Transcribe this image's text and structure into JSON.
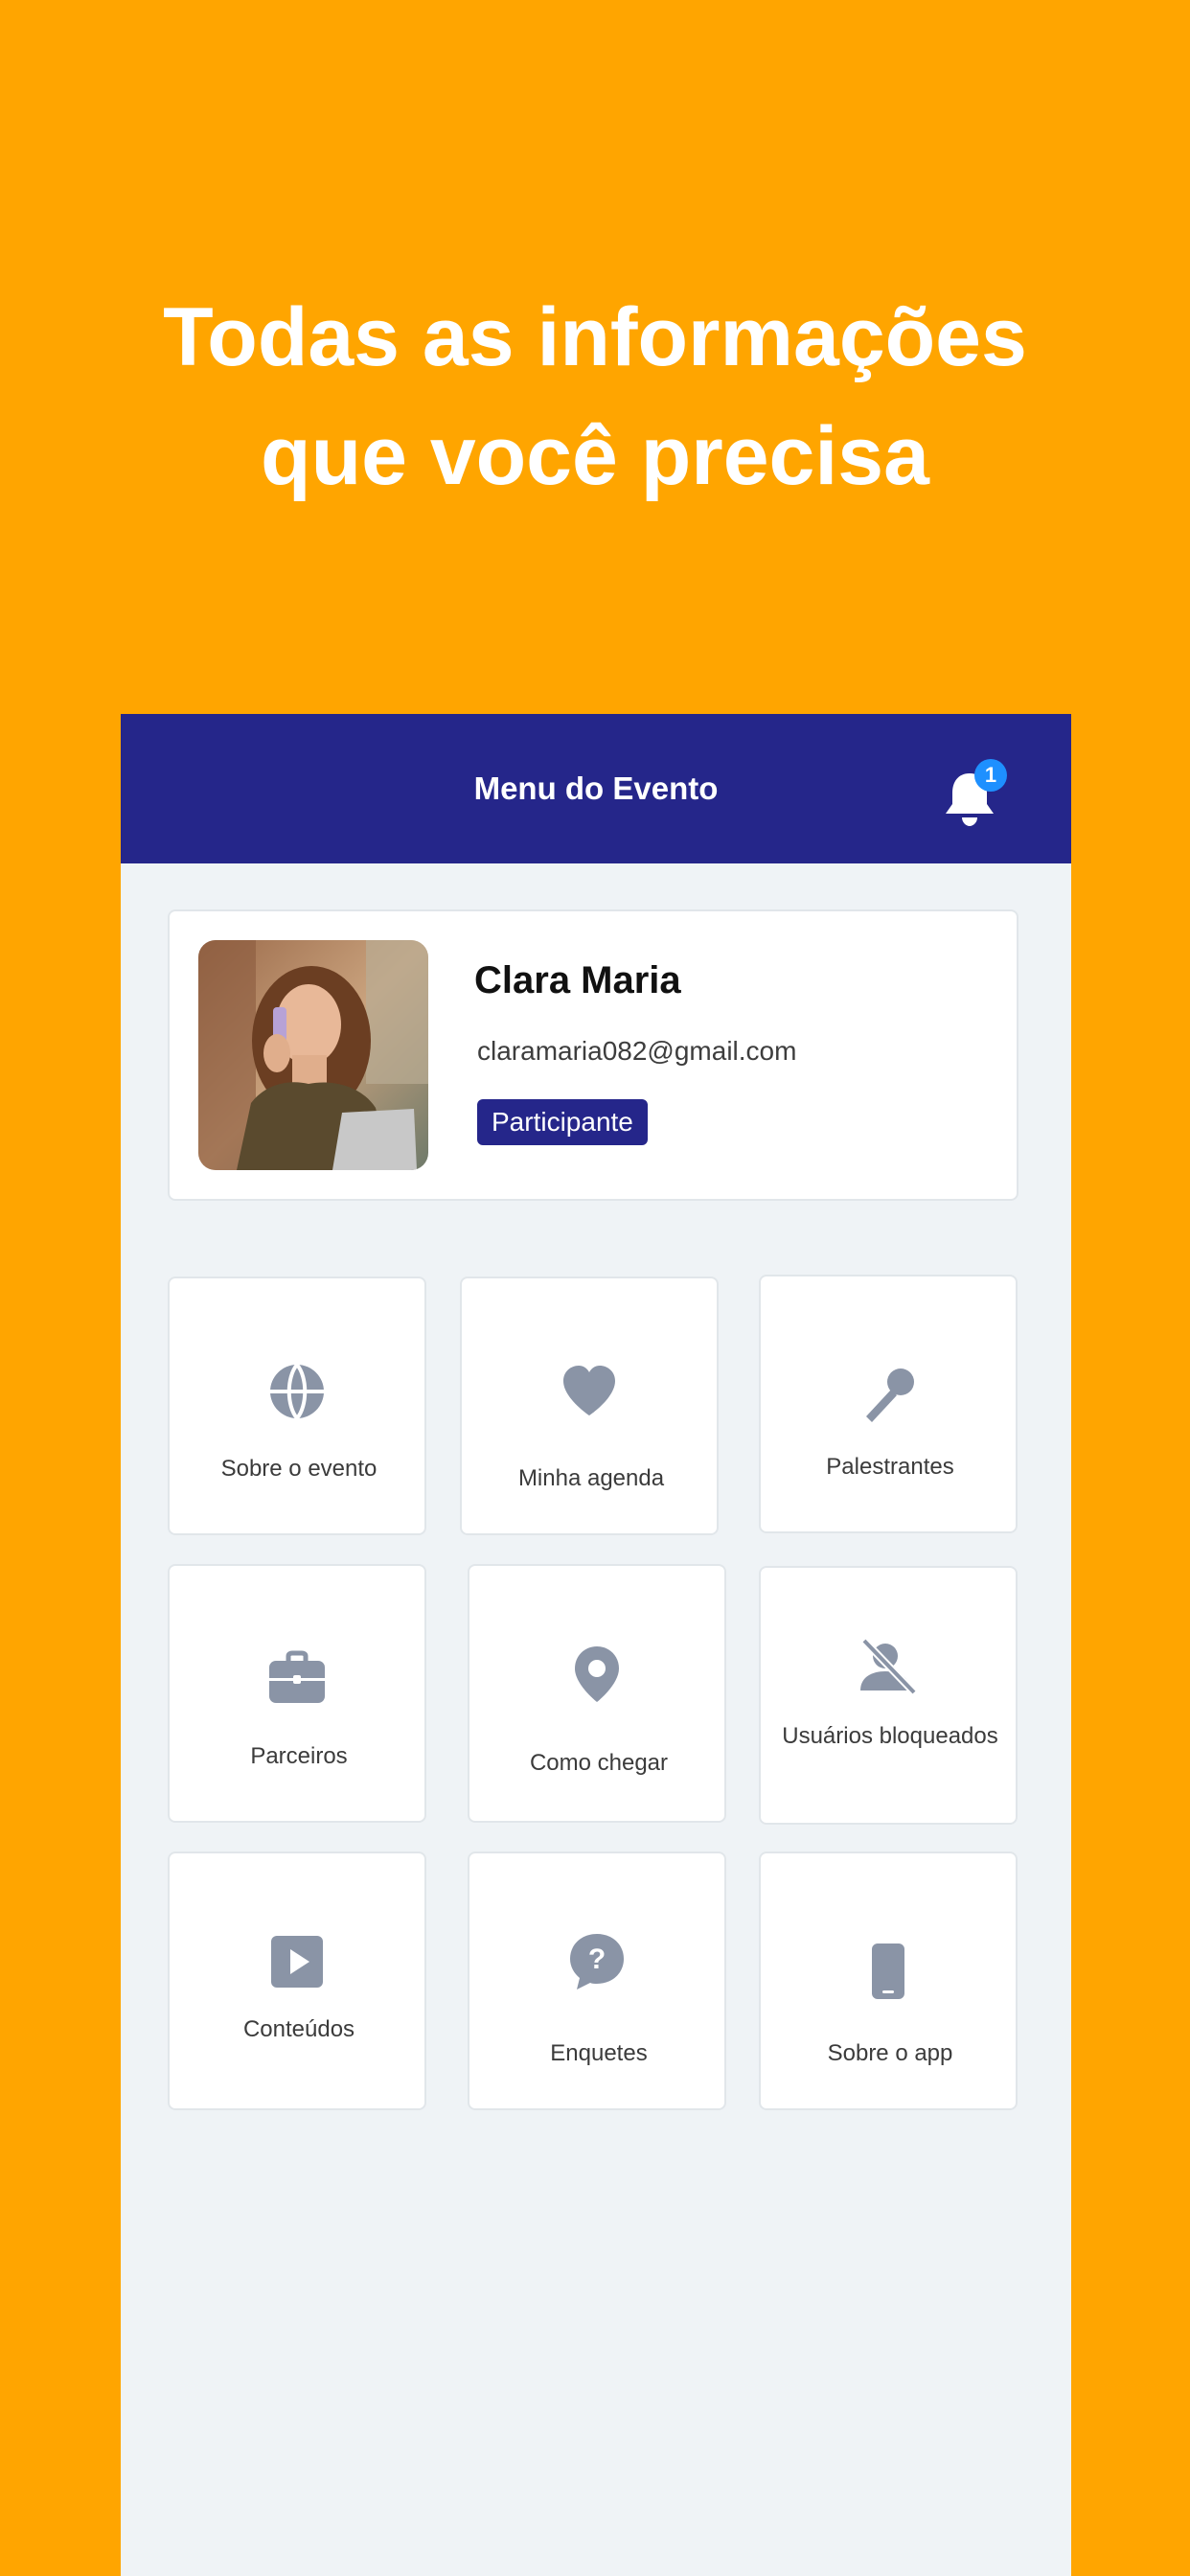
{
  "headline": {
    "line1": "Todas as informações",
    "line2": "que você precisa"
  },
  "header": {
    "title": "Menu do Evento",
    "notification_icon": "bell-icon",
    "notification_count": "1"
  },
  "profile": {
    "name": "Clara Maria",
    "email": "claramaria082@gmail.com",
    "role": "Participante",
    "avatar_icon": "user-photo"
  },
  "menu": {
    "items": [
      {
        "label": "Sobre o evento",
        "icon": "globe-icon"
      },
      {
        "label": "Minha agenda",
        "icon": "heart-icon"
      },
      {
        "label": "Palestrantes",
        "icon": "microphone-icon"
      },
      {
        "label": "Parceiros",
        "icon": "briefcase-icon"
      },
      {
        "label": "Como chegar",
        "icon": "location-pin-icon"
      },
      {
        "label": "Usuários bloqueados",
        "icon": "blocked-user-icon"
      },
      {
        "label": "Conteúdos",
        "icon": "play-icon"
      },
      {
        "label": "Enquetes",
        "icon": "question-bubble-icon"
      },
      {
        "label": "Sobre o app",
        "icon": "mobile-phone-icon"
      }
    ]
  },
  "colors": {
    "background": "#FFA500",
    "header": "#25268A",
    "badge": "#1E90FF",
    "icon": "#8A94A6",
    "screen": "#EFF3F6"
  }
}
